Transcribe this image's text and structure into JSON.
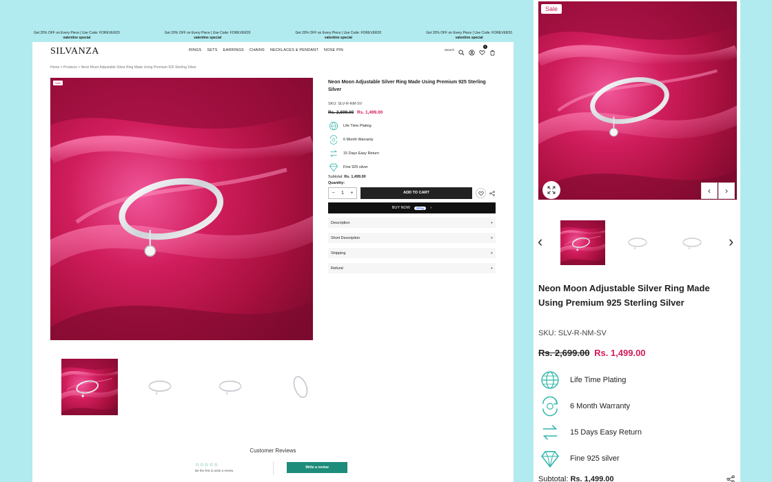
{
  "promo": {
    "items": [
      {
        "line1": "Get 20% OFF on Every Piece | Use Code: FOREVER20",
        "line2": "valentine special"
      },
      {
        "line1": "Get 20% OFF on Every Piece | Use Code: FOREVER20",
        "line2": "valentine special"
      },
      {
        "line1": "Get 20% OFF on Every Piece | Use Code: FOREVER20",
        "line2": "valentine special"
      },
      {
        "line1": "Get 20% OFF on Every Piece | Use Code: FOREVER20",
        "line2": "valentine special"
      }
    ]
  },
  "header": {
    "logo": "SILVANZA",
    "nav": [
      "RINGS",
      "SETS",
      "EARRINGS",
      "CHAINS",
      "NECKLACES & PENDANT",
      "NOSE PIN"
    ],
    "search_label": "Search",
    "wishlist_count": "0"
  },
  "breadcrumb": "Home > Products > Neon Moon Adjustable Silver Ring Made Using Premium 925 Sterling Silver",
  "product": {
    "sale_label": "Sale",
    "title": "Neon Moon Adjustable Silver Ring Made Using Premium 925 Sterling Silver",
    "sku": "SKU:  SLV-R-NM-SV",
    "price_old": "Rs. 2,699.00",
    "price_new": "Rs. 1,499.00",
    "features": [
      "Life Time Plating",
      "6 Month Warranty",
      "15 Days Easy Return",
      "Fine 925 silver"
    ],
    "subtotal_label": "Subtotal:",
    "subtotal_value": "Rs. 1,499.00",
    "quantity_label": "Quantity:",
    "quantity": "1",
    "qty_minus": "−",
    "qty_plus": "+",
    "add_to_cart": "ADD TO CART",
    "buy_now": "BUY NOW",
    "gpay": "GPay"
  },
  "accordion": [
    {
      "label": "Description",
      "icon": "+"
    },
    {
      "label": "Short Description",
      "icon": "+"
    },
    {
      "label": "Shipping",
      "icon": "+"
    },
    {
      "label": "Refund",
      "icon": "+"
    }
  ],
  "reviews": {
    "title": "Customer Reviews",
    "stars": "☆☆☆☆☆",
    "first_review": "Be the first to write a review",
    "write_button": "Write a review"
  },
  "mobile": {
    "sale_label": "Sale",
    "title": "Neon Moon Adjustable Silver Ring Made Using Premium 925 Sterling Silver",
    "sku": "SKU:  SLV-R-NM-SV",
    "price_old": "Rs. 2,699.00",
    "price_new": "Rs. 1,499.00",
    "features": [
      "Life Time Plating",
      "6 Month Warranty",
      "15 Days Easy Return",
      "Fine 925 silver"
    ],
    "subtotal_label": "Subtotal:",
    "subtotal_value": "Rs. 1,499.00",
    "prev": "‹",
    "next": "›"
  },
  "colors": {
    "accent_teal": "#1e8c7a",
    "sale_pink": "#d3195a",
    "background": "#b1ebef",
    "satin": "#c0164e"
  }
}
